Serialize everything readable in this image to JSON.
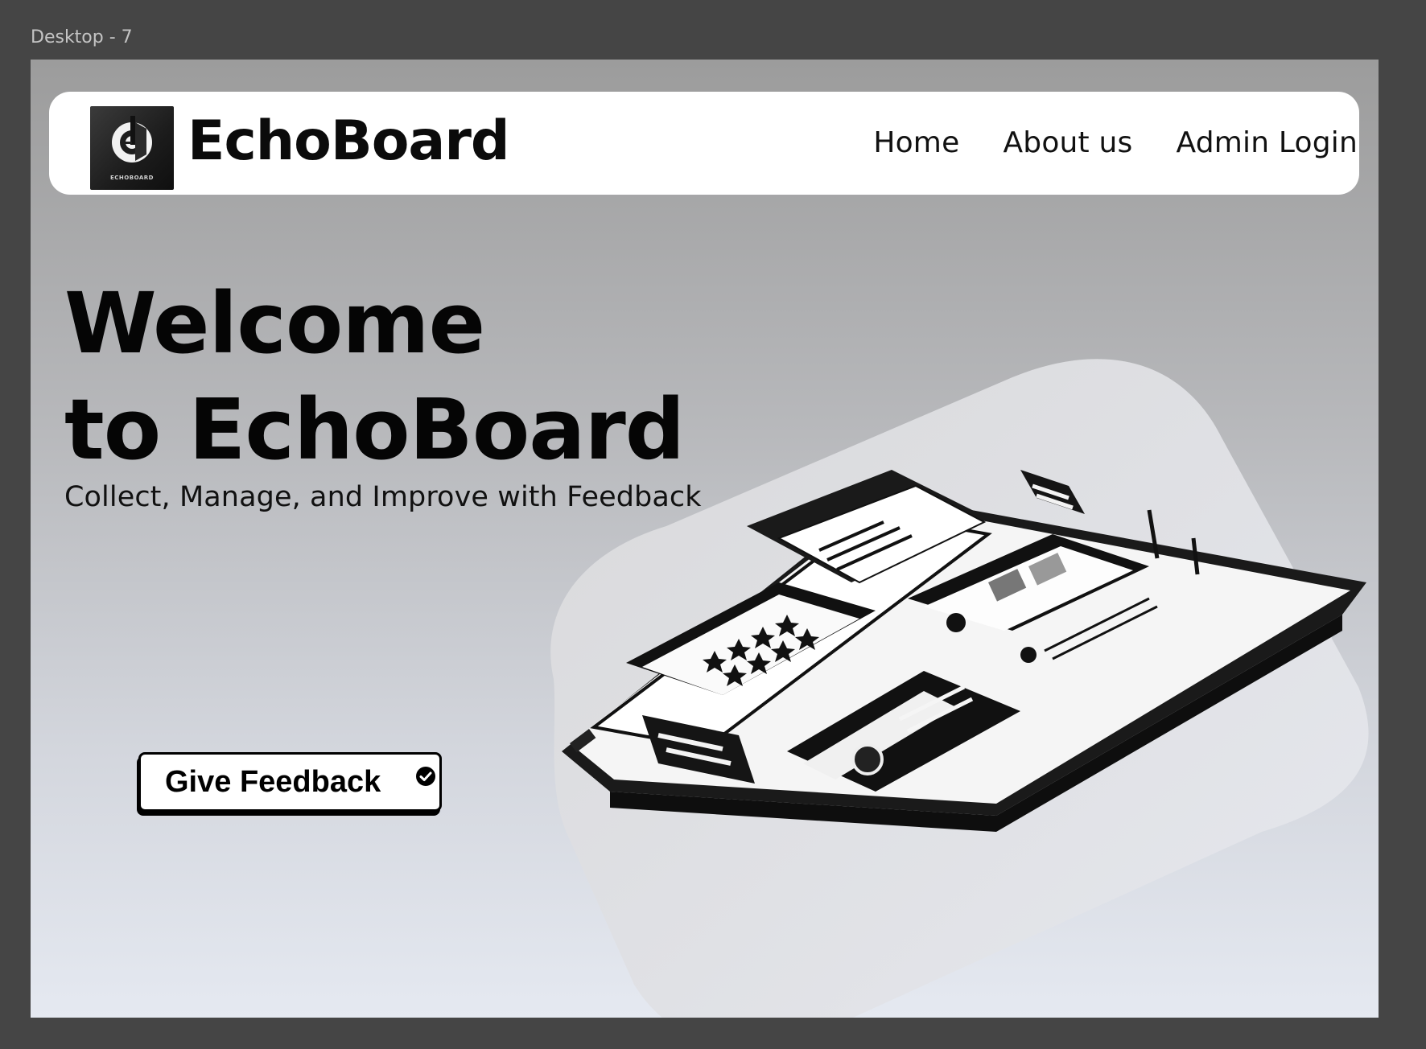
{
  "frame_label": "Desktop - 7",
  "navbar": {
    "logo_text": "ECHOBOARD",
    "brand_name": "EchoBoard",
    "links": [
      "Home",
      "About us",
      "Admin Login"
    ]
  },
  "hero": {
    "title_line1": "Welcome",
    "title_line2": "to EchoBoard",
    "subtitle": "Collect, Manage, and Improve with Feedback",
    "cta_label": "Give Feedback"
  },
  "icons": {
    "cta": "check-circle-icon",
    "logo": "echo-logo-icon"
  },
  "colors": {
    "canvas": "#454545",
    "navbar_bg": "#ffffff",
    "text": "#0b0b0b"
  }
}
